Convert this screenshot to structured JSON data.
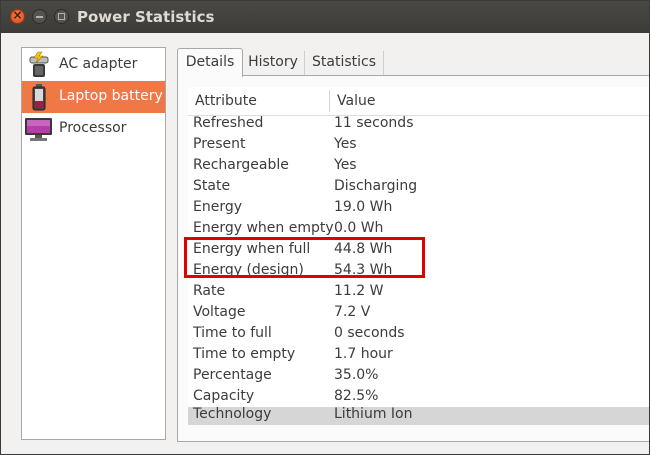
{
  "window": {
    "title": "Power Statistics"
  },
  "sidebar": {
    "items": [
      {
        "label": "AC adapter",
        "icon": "ac-adapter-icon",
        "selected": false
      },
      {
        "label": "Laptop battery",
        "icon": "battery-icon",
        "selected": true
      },
      {
        "label": "Processor",
        "icon": "processor-icon",
        "selected": false
      }
    ]
  },
  "tabs": [
    {
      "label": "Details",
      "active": true
    },
    {
      "label": "History",
      "active": false
    },
    {
      "label": "Statistics",
      "active": false
    }
  ],
  "table": {
    "headers": [
      "Attribute",
      "Value"
    ],
    "rows": [
      {
        "attribute": "Refreshed",
        "value": "11 seconds"
      },
      {
        "attribute": "Present",
        "value": "Yes"
      },
      {
        "attribute": "Rechargeable",
        "value": "Yes"
      },
      {
        "attribute": "State",
        "value": "Discharging"
      },
      {
        "attribute": "Energy",
        "value": "19.0 Wh"
      },
      {
        "attribute": "Energy when empty",
        "value": "0.0 Wh"
      },
      {
        "attribute": "Energy when full",
        "value": "44.8 Wh"
      },
      {
        "attribute": "Energy (design)",
        "value": "54.3 Wh"
      },
      {
        "attribute": "Rate",
        "value": "11.2 W"
      },
      {
        "attribute": "Voltage",
        "value": "7.2 V"
      },
      {
        "attribute": "Time to full",
        "value": "0 seconds"
      },
      {
        "attribute": "Time to empty",
        "value": "1.7 hour"
      },
      {
        "attribute": "Percentage",
        "value": "35.0%"
      },
      {
        "attribute": "Capacity",
        "value": "82.5%"
      },
      {
        "attribute": "Technology",
        "value": "Lithium Ion"
      }
    ]
  },
  "colors": {
    "selection": "#f07746",
    "highlight_box": "#e00000",
    "titlebar": "#3c3b37"
  }
}
